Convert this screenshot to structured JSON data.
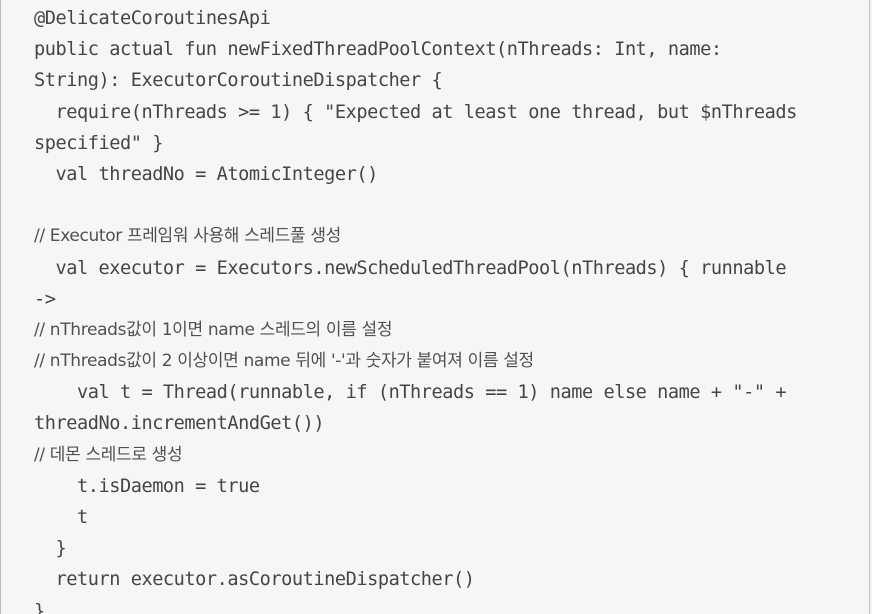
{
  "code": {
    "lines": [
      "@DelicateCoroutinesApi",
      "public actual fun newFixedThreadPoolContext(nThreads: Int, name:",
      "String): ExecutorCoroutineDispatcher {",
      "  require(nThreads >= 1) { \"Expected at least one thread, but $nThreads",
      "specified\" }",
      "  val threadNo = AtomicInteger()",
      "",
      "// Executor 프레임워 사용해 스레드풀 생성",
      "  val executor = Executors.newScheduledThreadPool(nThreads) { runnable",
      "->",
      "// nThreads값이 1이면 name 스레드의 이름 설정",
      "// nThreads값이 2 이상이면 name 뒤에 '-'과 숫자가 붙여져 이름 설정",
      "    val t = Thread(runnable, if (nThreads == 1) name else name + \"-\" +",
      "threadNo.incrementAndGet())",
      "// 데몬 스레드로 생성",
      "    t.isDaemon = true",
      "    t",
      "  }",
      "  return executor.asCoroutineDispatcher()",
      "}"
    ]
  }
}
